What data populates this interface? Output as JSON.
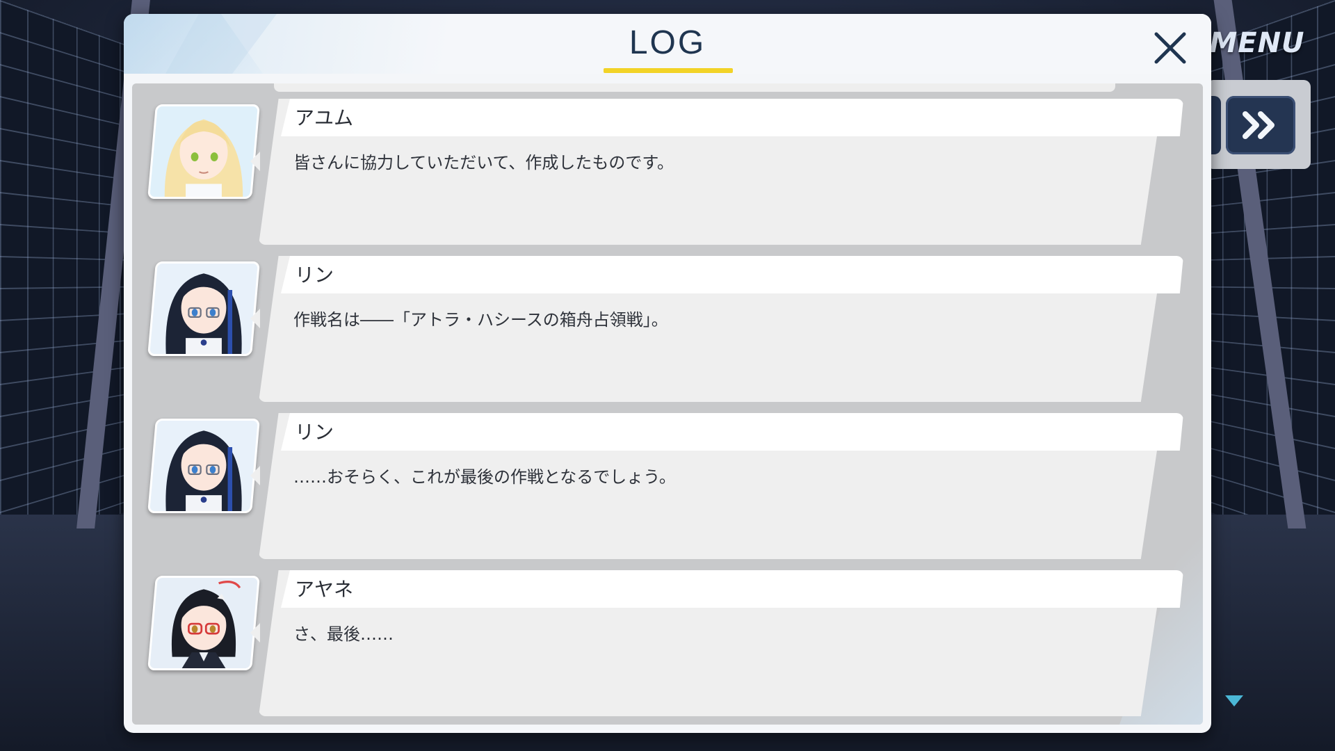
{
  "log_window": {
    "title": "LOG",
    "close_icon": "close-icon",
    "entries": [
      {
        "speaker": "アユム",
        "text": "皆さんに協力していただいて、作成したものです。",
        "portrait_icon": "ayumu-portrait"
      },
      {
        "speaker": "リン",
        "text": "作戦名は――「アトラ・ハシースの箱舟占領戦」。",
        "portrait_icon": "rin-portrait"
      },
      {
        "speaker": "リン",
        "text": "……おそらく、これが最後の作戦となるでしょう。",
        "portrait_icon": "rin-portrait"
      },
      {
        "speaker": "アヤネ",
        "text": "さ、最後……",
        "portrait_icon": "ayane-portrait"
      }
    ]
  },
  "hud": {
    "menu_label": "MENU",
    "fast_forward_icon": "fast-forward-icon",
    "scroll_down_icon": "scroll-down-icon"
  },
  "colors": {
    "title_underline": "#f2d327",
    "title_text": "#1f3550",
    "button_dark": "#243552",
    "scroll_arrow": "#4bb7d6"
  }
}
